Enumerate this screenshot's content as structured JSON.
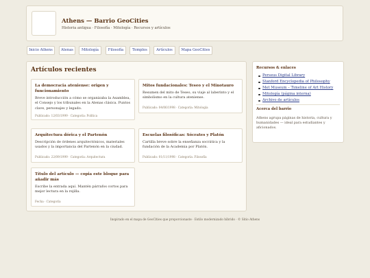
{
  "header": {
    "title": "Athens — Barrio GeoCities",
    "subtitle": "Historia antigua · Filosofía · Mitología · Recursos y artículos"
  },
  "nav": [
    {
      "label": "Inicio Athens"
    },
    {
      "label": "Atenas"
    },
    {
      "label": "Mitología"
    },
    {
      "label": "Filosofía"
    },
    {
      "label": "Templos"
    },
    {
      "label": "Artículos"
    },
    {
      "label": "Mapa GeoCities"
    }
  ],
  "main": {
    "heading": "Artículos recientes",
    "cards": [
      {
        "title": "La democracia ateniense: origen y funcionamiento",
        "text": "Breve introducción a cómo se organizaba la Asamblea, el Consejo y los tribunales en la Atenas clásica. Puntos clave, personajes y legado.",
        "meta": "Publicado: 12/03/1999 · Categoría: Política"
      },
      {
        "title": "Mitos fundacionales: Teseo y el Minotauro",
        "text": "Resumen del mito de Teseo, su viaje al laberinto y el simbolismo en la cultura ateniense.",
        "meta": "Publicado: 04/06/1998 · Categoría: Mitología"
      },
      {
        "title": "Arquitectura dórica y el Partenón",
        "text": "Descripción de órdenes arquitectónicos, materiales usados y la importancia del Partenón en la ciudad.",
        "meta": "Publicado: 22/09/1999 · Categoría: Arquitectura"
      },
      {
        "title": "Escuelas filosóficas: Sócrates y Platón",
        "text": "Cartilla breve sobre la enseñanza socrática y la fundación de la Academia por Platón.",
        "meta": "Publicado: 01/11/1998 · Categoría: Filosofía"
      },
      {
        "title": "Título del artículo — copia este bloque para añadir más",
        "text": "Escribe la entrada aquí. Mantén párrafos cortos para mejor lectura en la rejilla.",
        "meta": "Fecha · Categoría"
      }
    ]
  },
  "sidebar": {
    "heading": "Recursos & enlaces",
    "links": [
      {
        "label": "Perseus Digital Library"
      },
      {
        "label": "Stanford Encyclopedia of Philosophy"
      },
      {
        "label": "Met Museum – Timeline of Art History"
      },
      {
        "label": "Mitología (página interna)"
      },
      {
        "label": "Archivo de artículos"
      }
    ],
    "about_heading": "Acerca del barrio",
    "about_text": "Athens agrupa páginas de historia, cultura y humanidades — ideal para estudiantes y aficionados."
  },
  "footer": {
    "text": "Inspirado en el mapa de GeoCities que proporcionaste · Estilo modernizado híbrido · © Sitio Athens"
  }
}
